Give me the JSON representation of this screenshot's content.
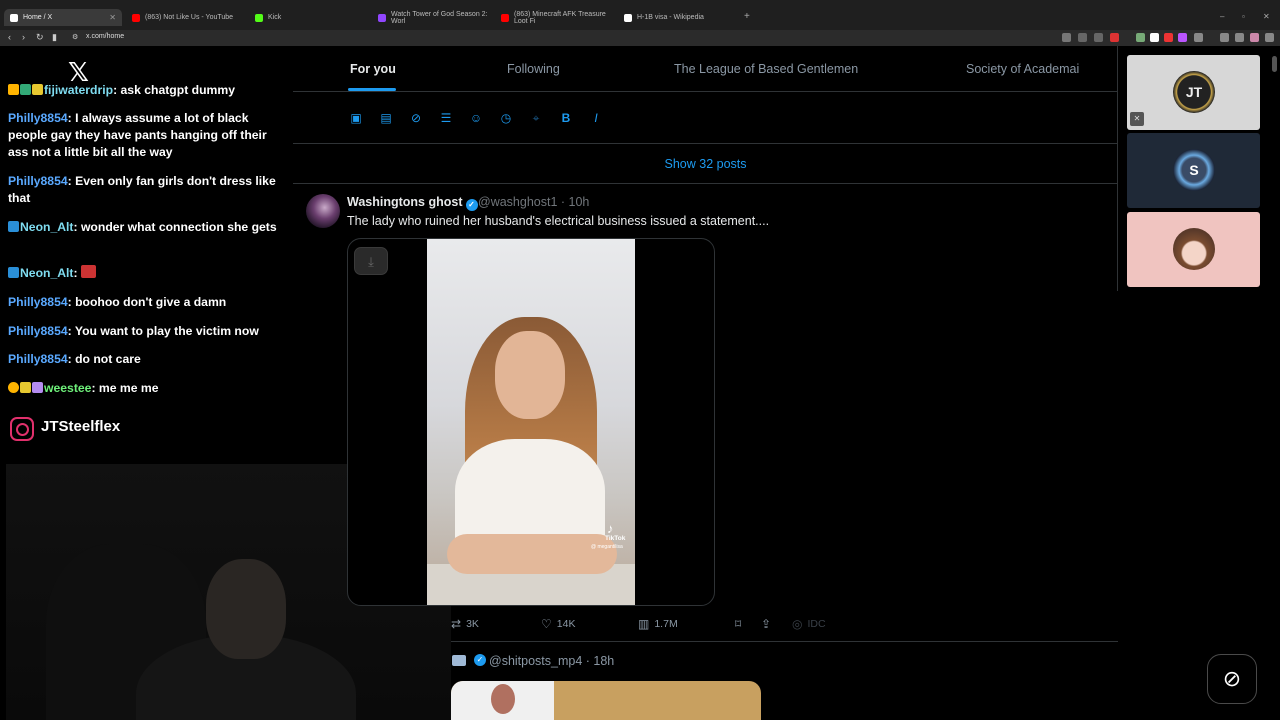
{
  "browser": {
    "tabs": [
      {
        "label": "Home / X",
        "color": "#ffffff"
      },
      {
        "label": "(863) Not Like Us - YouTube",
        "color": "#ff0000"
      },
      {
        "label": "Kick",
        "color": "#53fc18"
      },
      {
        "label": "Watch Tower of God Season 2: Worl",
        "color": "#9146ff"
      },
      {
        "label": "(863) Minecraft AFK Treasure Loot Fi",
        "color": "#ff0000"
      },
      {
        "label": "H-1B visa - Wikipedia",
        "color": "#ffffff"
      }
    ],
    "url": "x.com/home"
  },
  "chat": {
    "messages": [
      {
        "user": "fijiwaterdrip",
        "text": ": ask chatgpt dummy",
        "color": "cyan"
      },
      {
        "user": "Philly8854",
        "text": ": I always assume a lot of black people gay they have pants hanging off their ass not a little bit all the way",
        "color": "blue"
      },
      {
        "user": "Philly8854",
        "text": ": Even only fan girls don't dress like that",
        "color": "blue"
      },
      {
        "user": "Neon_Alt",
        "text": ": wonder what connection she gets",
        "color": "cyan"
      },
      {
        "user": "Neon_Alt",
        "text": ":",
        "color": "cyan"
      },
      {
        "user": "Philly8854",
        "text": ": boohoo don't give a damn",
        "color": "blue"
      },
      {
        "user": "Philly8854",
        "text": ": You want to play the victim now",
        "color": "blue"
      },
      {
        "user": "Philly8854",
        "text": ": do not care",
        "color": "blue"
      },
      {
        "user": "weestee",
        "text": ": me me me",
        "color": "green"
      }
    ],
    "instagram_handle": "JTSteelflex"
  },
  "feed": {
    "tabs": [
      "For you",
      "Following",
      "The League of Based Gentlemen",
      "Society of Academai"
    ],
    "show_posts": "Show 32 posts",
    "post": {
      "name": "Washingtons ghost",
      "handle": "@washghost1 · 10h",
      "text": "The lady who ruined her husband's electrical business issued a statement....",
      "tiktok_label": "TikTok",
      "tiktok_user": "@ megantilisa",
      "retweets": "3K",
      "likes": "14K",
      "views": "1.7M",
      "grok_label": "IDC"
    },
    "post2": {
      "handle": "@shitposts_mp4 · 18h"
    }
  },
  "sidebar_cams": {
    "cam1_label": "JT",
    "cam2_label": "S"
  }
}
